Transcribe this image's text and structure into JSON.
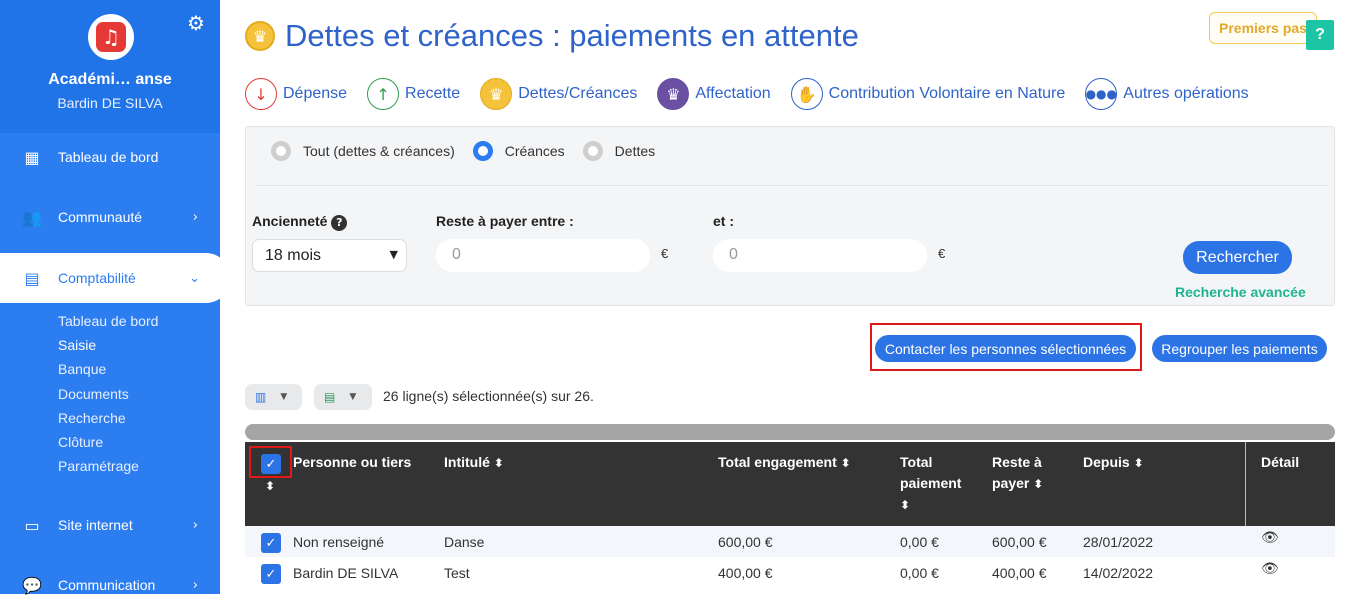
{
  "sidebar": {
    "org_name": "Académi… anse",
    "user_name": "Bardin DE SILVA",
    "logo_icon": "music-note-icon",
    "settings_icon": "gear-icon",
    "items": [
      {
        "label": "Tableau de bord",
        "icon": "dashboard-icon"
      },
      {
        "label": "Communauté",
        "icon": "people-icon"
      },
      {
        "label": "Comptabilité",
        "icon": "calculator-icon"
      },
      {
        "label": "Site internet",
        "icon": "laptop-icon"
      },
      {
        "label": "Communication",
        "icon": "chat-icon"
      }
    ],
    "sub_items": [
      "Tableau de bord",
      "Saisie",
      "Banque",
      "Documents",
      "Recherche",
      "Clôture",
      "Paramétrage"
    ]
  },
  "header": {
    "title": "Dettes et créances : paiements en attente",
    "premiers_pas": "Premiers pas",
    "help": "?"
  },
  "operations": [
    {
      "label": "Dépense",
      "icon": "arrow-down-icon",
      "color": "#e53935"
    },
    {
      "label": "Recette",
      "icon": "arrow-up-icon",
      "color": "#2e9e4f"
    },
    {
      "label": "Dettes/Créances",
      "icon": "crown-icon",
      "color": "#f5c33b"
    },
    {
      "label": "Affectation",
      "icon": "crown-arrows-icon",
      "color": "#6a4fa3"
    },
    {
      "label": "Contribution Volontaire en Nature",
      "icon": "hand-icon",
      "color": "#2f63c9"
    },
    {
      "label": "Autres opérations",
      "icon": "more-icon",
      "color": "#2f63c9"
    }
  ],
  "filters": {
    "radios": [
      "Tout (dettes & créances)",
      "Créances",
      "Dettes"
    ],
    "selected_radio": "Créances",
    "anciennete_label": "Ancienneté",
    "anciennete_value": "18 mois",
    "reste_label": "Reste à payer entre :",
    "et_label": "et :",
    "min_placeholder": "0",
    "max_placeholder": "0",
    "currency": "€",
    "search_button": "Rechercher",
    "advanced_search": "Recherche avancée"
  },
  "actions": {
    "contact": "Contacter les personnes sélectionnées",
    "group": "Regrouper les paiements"
  },
  "selection_info": "26 ligne(s) sélectionnée(s) sur 26.",
  "table": {
    "columns": [
      "Personne ou tiers",
      "Intitulé",
      "Total engagement",
      "Total paiement",
      "Reste à payer",
      "Depuis",
      "Détail"
    ],
    "rows": [
      {
        "person": "Non renseigné",
        "label": "Danse",
        "engagement": "600,00 €",
        "paiement": "0,00 €",
        "reste": "600,00 €",
        "since": "28/01/2022"
      },
      {
        "person": "Bardin DE SILVA",
        "label": "Test",
        "engagement": "400,00 €",
        "paiement": "0,00 €",
        "reste": "400,00 €",
        "since": "14/02/2022"
      }
    ]
  }
}
